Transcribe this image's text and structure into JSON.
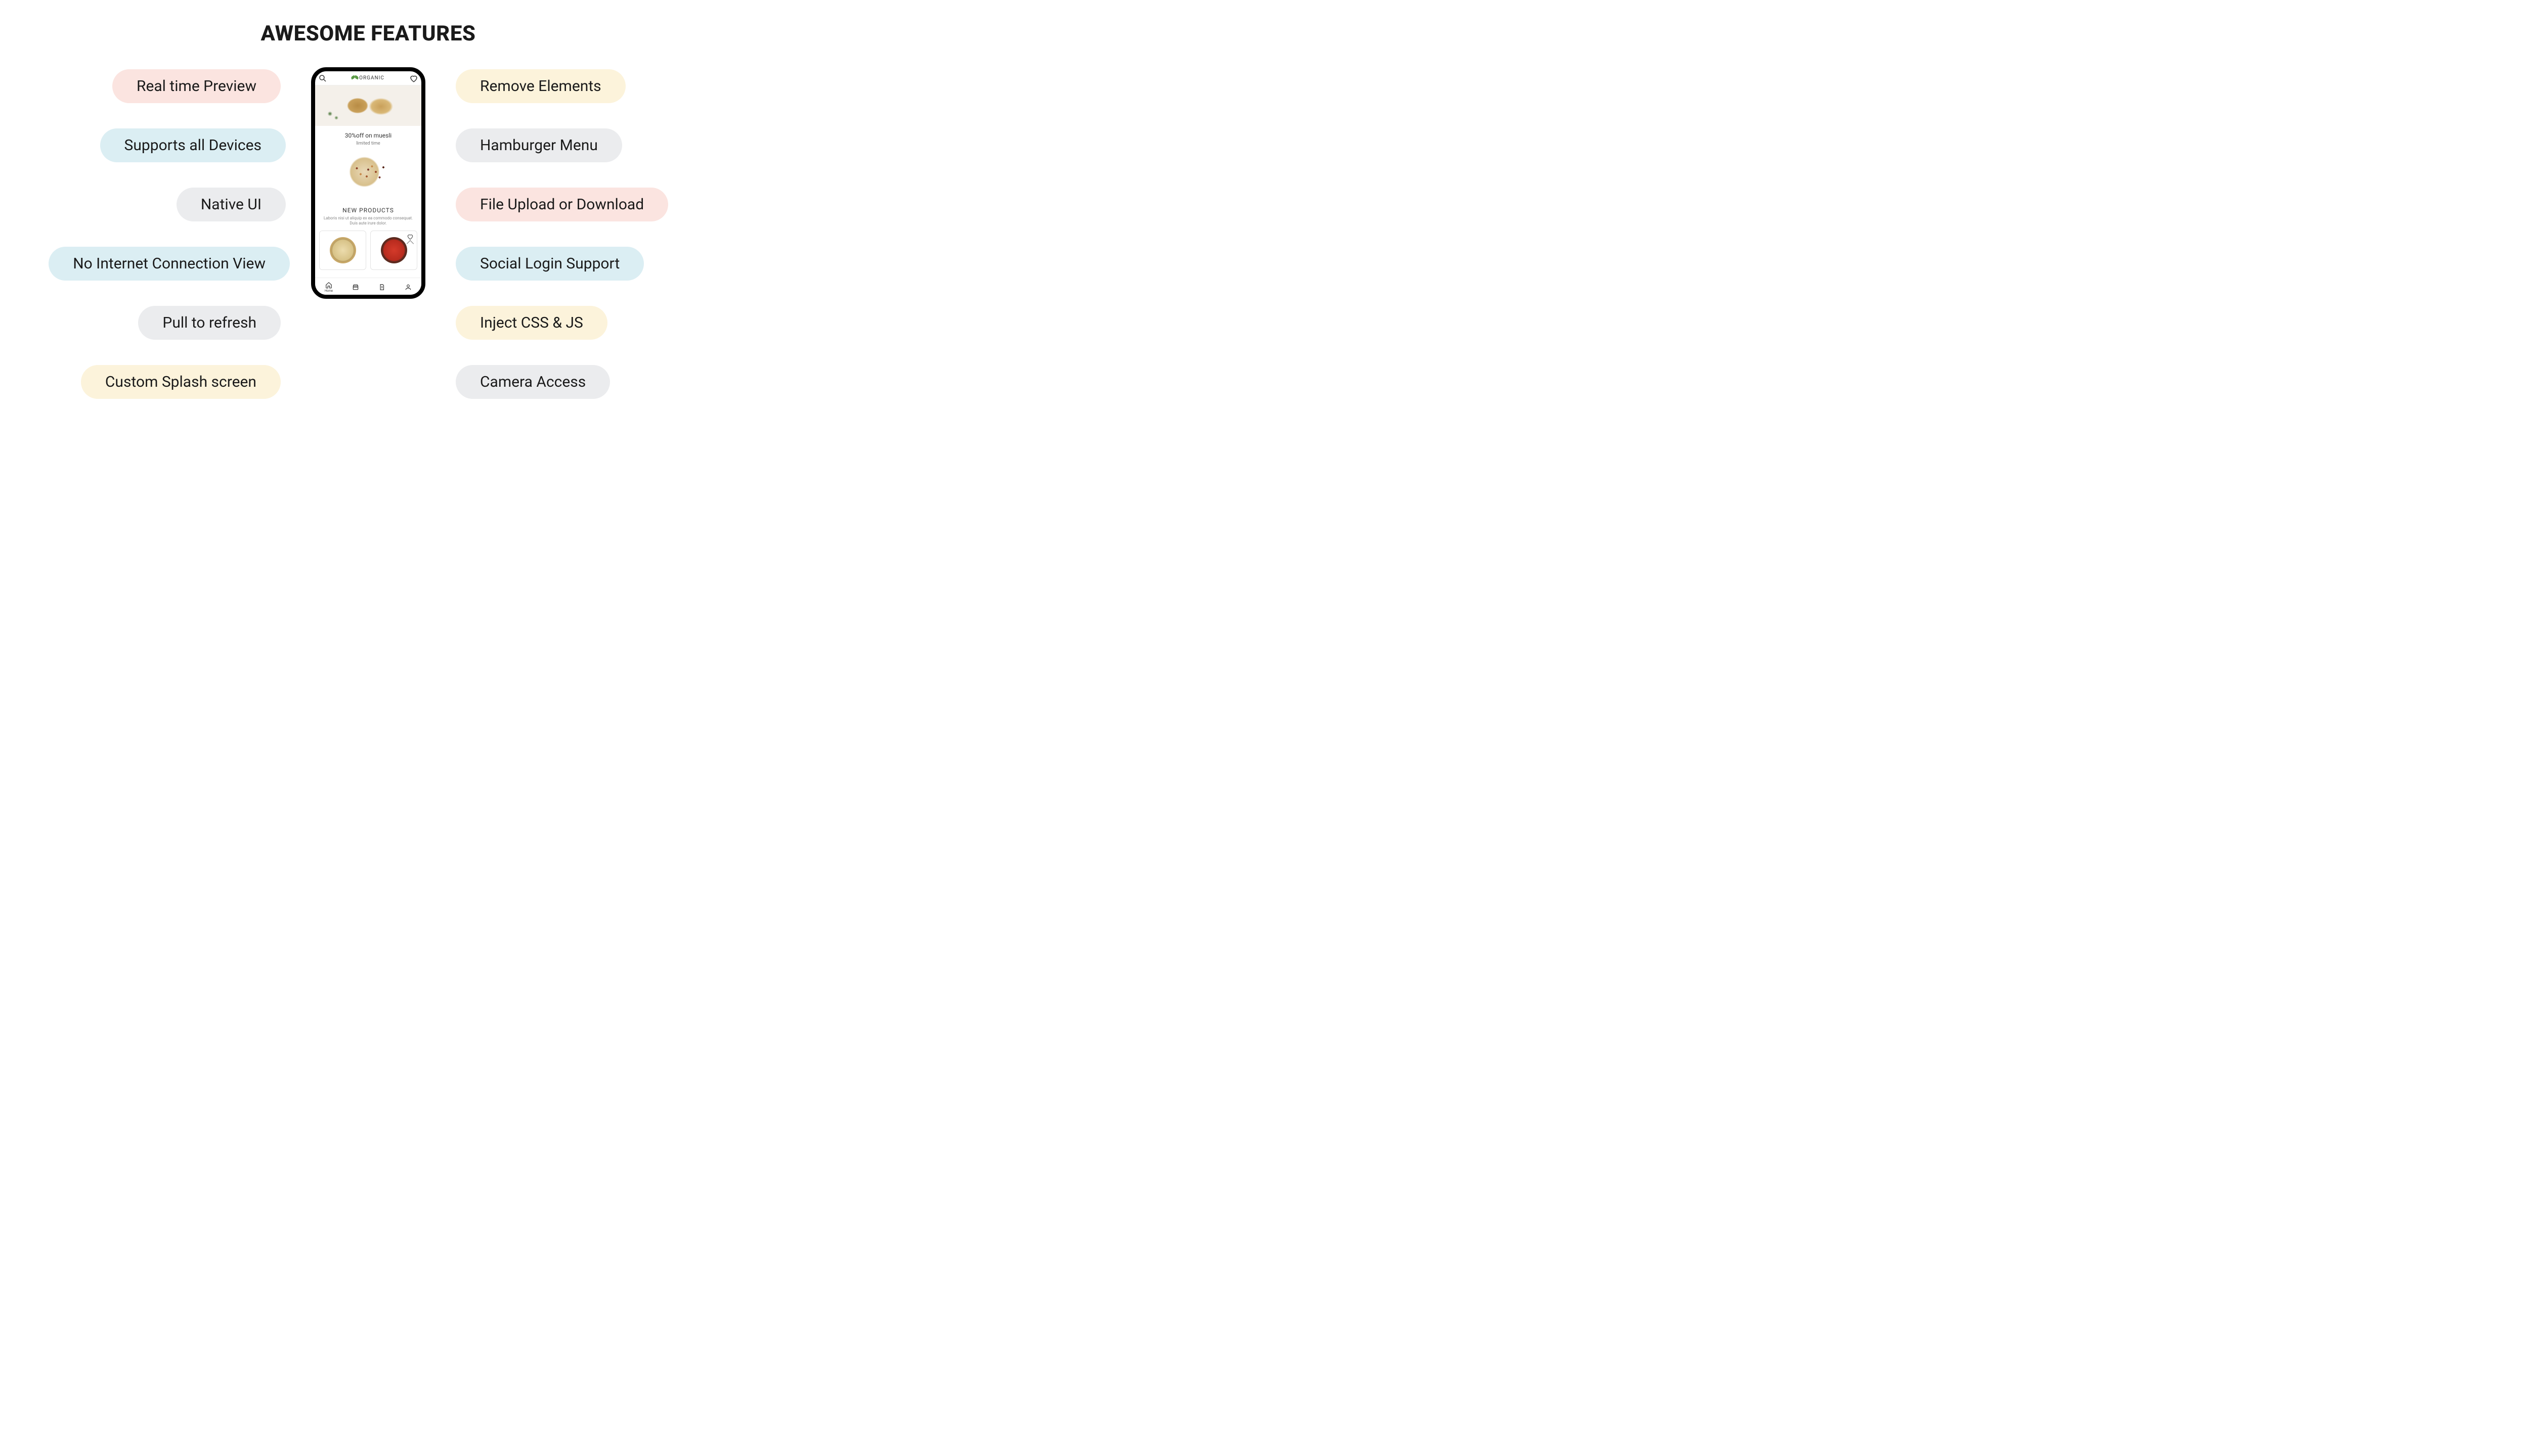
{
  "title": "AWESOME FEATURES",
  "left_features": [
    {
      "label": "Real time Preview",
      "color": "c-pink"
    },
    {
      "label": "Supports all Devices",
      "color": "c-blue"
    },
    {
      "label": "Native UI",
      "color": "c-grey"
    },
    {
      "label": "No Internet Connection View",
      "color": "c-blue"
    },
    {
      "label": "Pull to refresh",
      "color": "c-grey"
    },
    {
      "label": "Custom Splash screen",
      "color": "c-cream"
    }
  ],
  "right_features": [
    {
      "label": "Remove Elements",
      "color": "c-cream"
    },
    {
      "label": "Hamburger Menu",
      "color": "c-grey"
    },
    {
      "label": "File Upload or Download",
      "color": "c-pink"
    },
    {
      "label": "Social Login Support",
      "color": "c-blue"
    },
    {
      "label": "Inject CSS & JS",
      "color": "c-cream"
    },
    {
      "label": "Camera Access",
      "color": "c-grey"
    }
  ],
  "phone": {
    "brand": "ORGANIC",
    "promo_title": "30%off on muesli",
    "promo_sub": "limited time",
    "section_title": "NEW PRODUCTS",
    "section_sub": "Laboris nisi ut aliquip ex ea commodo consequat. Duis aute irure dolor.",
    "tabs": {
      "home": "Home"
    }
  }
}
